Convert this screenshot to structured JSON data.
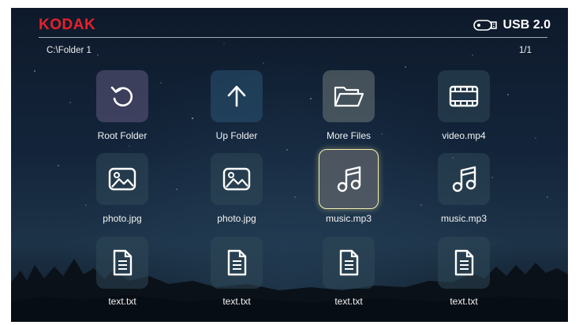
{
  "header": {
    "brand": "KODAK",
    "storage_label": "USB 2.0",
    "storage_icon": "usb-drive-icon"
  },
  "breadcrumb": {
    "path": "C:\\Folder 1",
    "page": "1/1"
  },
  "selected_index": 6,
  "items": [
    {
      "label": "Root Folder",
      "icon": "refresh-icon"
    },
    {
      "label": "Up Folder",
      "icon": "arrow-up-icon"
    },
    {
      "label": "More Files",
      "icon": "folder-open-icon"
    },
    {
      "label": "video.mp4",
      "icon": "film-icon"
    },
    {
      "label": "photo.jpg",
      "icon": "image-icon"
    },
    {
      "label": "photo.jpg",
      "icon": "image-icon"
    },
    {
      "label": "music.mp3",
      "icon": "music-note-icon"
    },
    {
      "label": "music.mp3",
      "icon": "music-note-icon"
    },
    {
      "label": "text.txt",
      "icon": "document-icon"
    },
    {
      "label": "text.txt",
      "icon": "document-icon"
    },
    {
      "label": "text.txt",
      "icon": "document-icon"
    },
    {
      "label": "text.txt",
      "icon": "document-icon"
    }
  ]
}
